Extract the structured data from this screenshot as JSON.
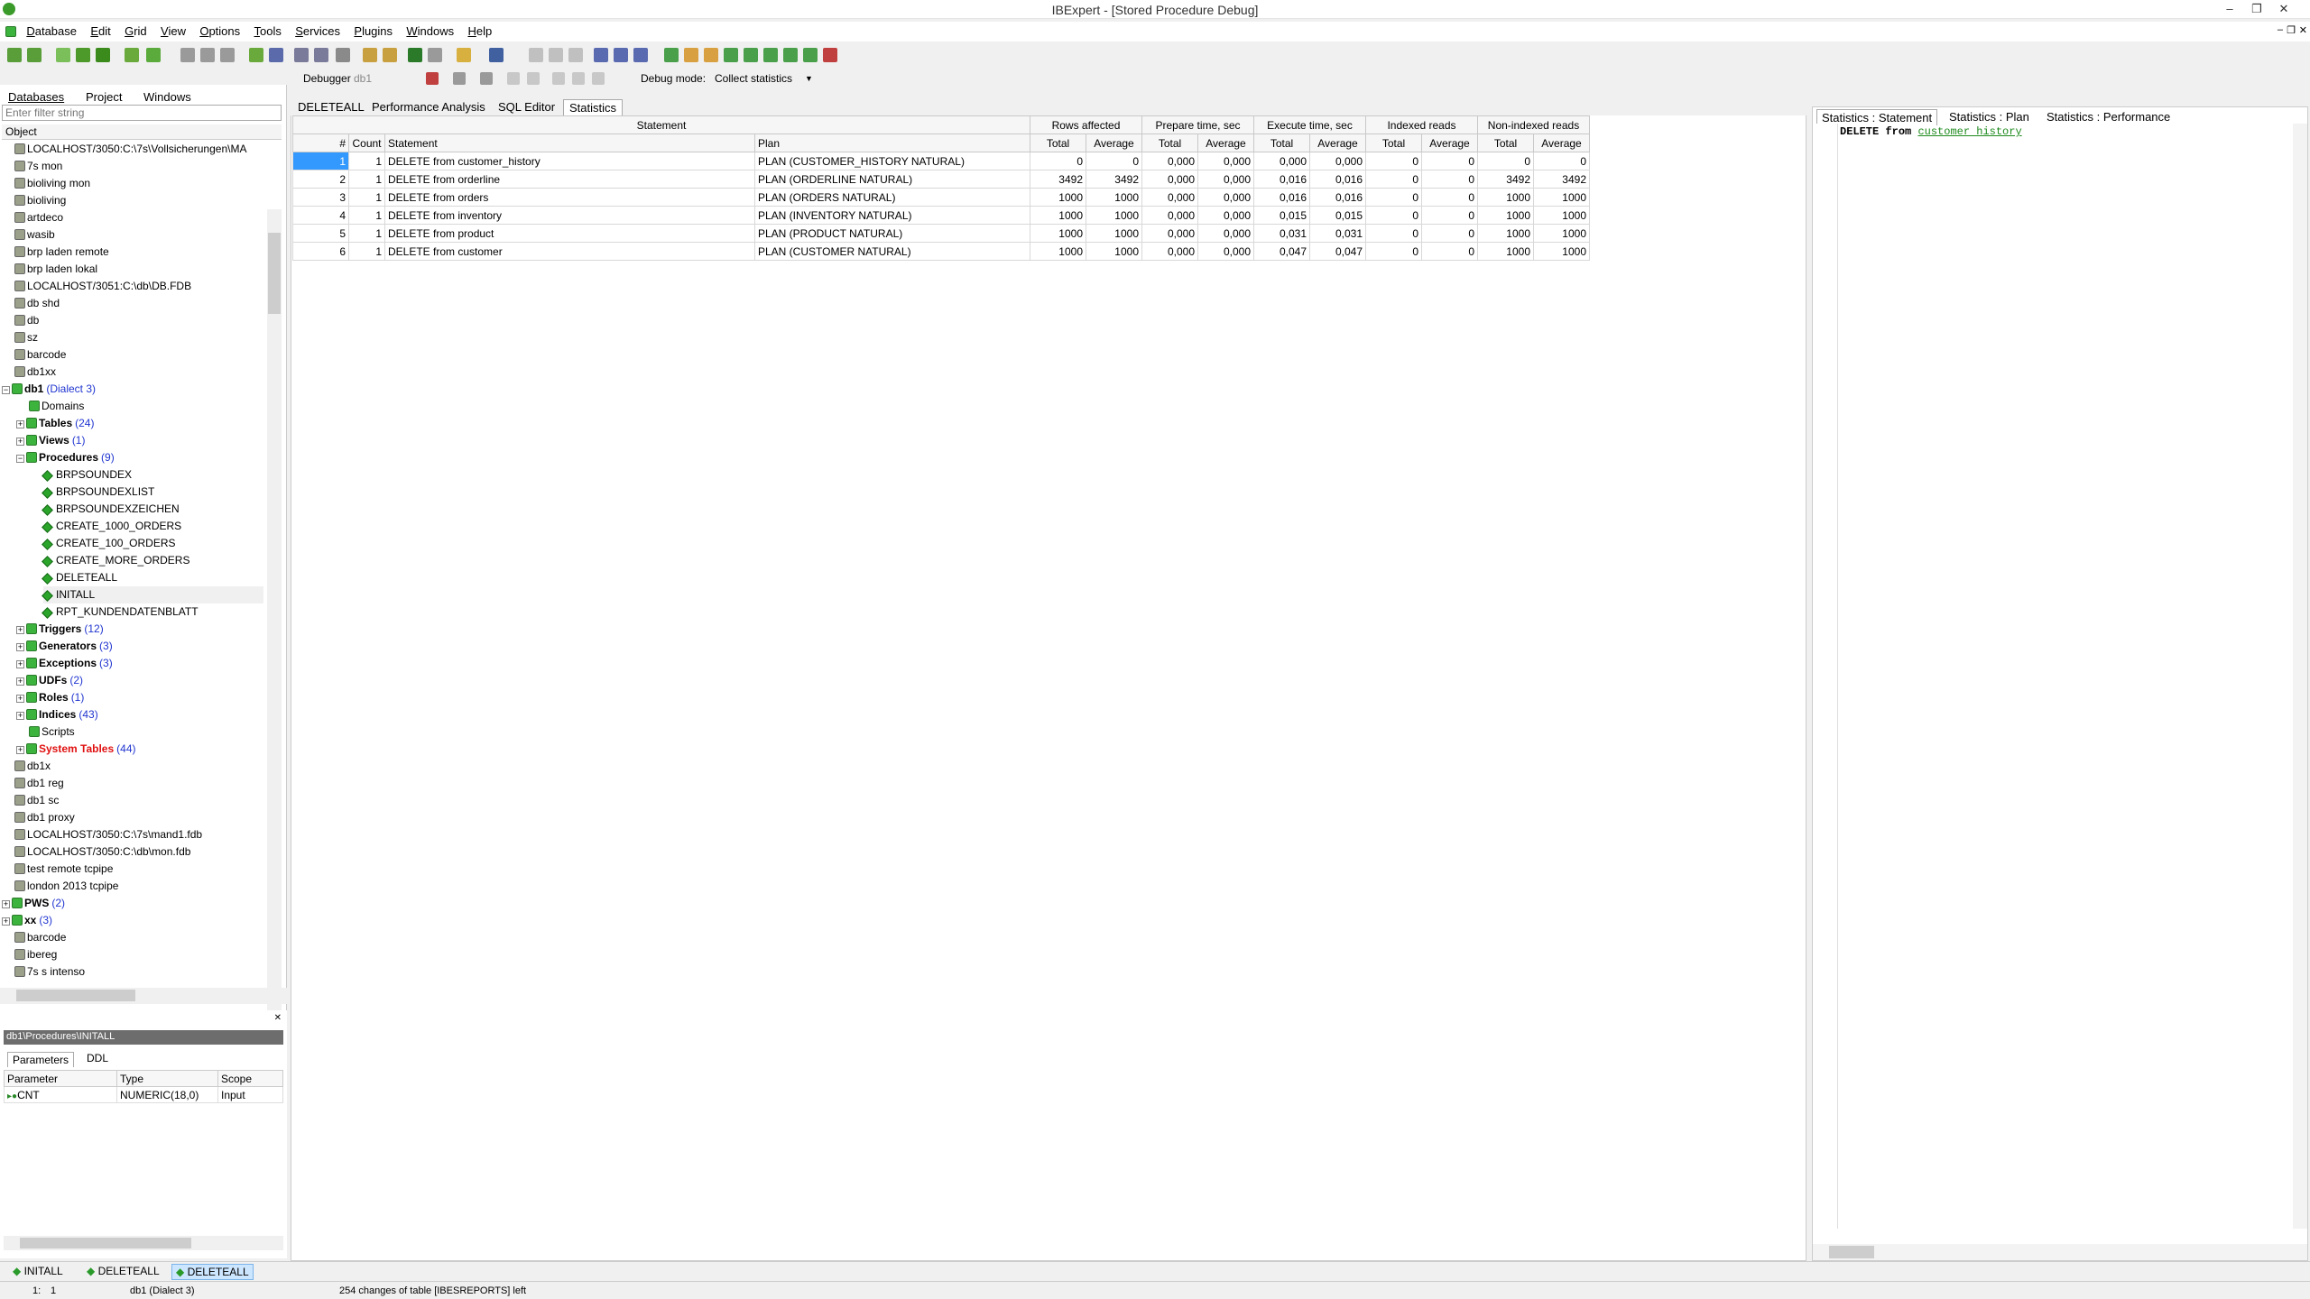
{
  "window": {
    "title": "IBExpert - [Stored Procedure Debug]"
  },
  "menu": [
    "Database",
    "Edit",
    "Grid",
    "View",
    "Options",
    "Tools",
    "Services",
    "Plugins",
    "Windows",
    "Help"
  ],
  "toolbar2": {
    "debugger_label": "Debugger",
    "db_label": "db1",
    "debug_mode_label": "Debug mode:",
    "debug_mode_value": "Collect statistics"
  },
  "left": {
    "tabs": [
      "Databases",
      "Project",
      "Windows"
    ],
    "filter_placeholder": "Enter filter string",
    "object_header": "Object",
    "tree": [
      {
        "label": "LOCALHOST/3050:C:\\7s\\Vollsicherungen\\MA",
        "indent": 0,
        "type": "db"
      },
      {
        "label": "7s mon",
        "indent": 0,
        "type": "db"
      },
      {
        "label": "bioliving mon",
        "indent": 0,
        "type": "db"
      },
      {
        "label": "bioliving",
        "indent": 0,
        "type": "db"
      },
      {
        "label": "artdeco",
        "indent": 0,
        "type": "db"
      },
      {
        "label": "wasib",
        "indent": 0,
        "type": "db"
      },
      {
        "label": "brp laden remote",
        "indent": 0,
        "type": "db"
      },
      {
        "label": "brp laden lokal",
        "indent": 0,
        "type": "db"
      },
      {
        "label": "LOCALHOST/3051:C:\\db\\DB.FDB",
        "indent": 0,
        "type": "db"
      },
      {
        "label": "db shd",
        "indent": 0,
        "type": "db"
      },
      {
        "label": "db",
        "indent": 0,
        "type": "db"
      },
      {
        "label": "sz",
        "indent": 0,
        "type": "db"
      },
      {
        "label": "barcode",
        "indent": 0,
        "type": "db"
      },
      {
        "label": "db1xx",
        "indent": 0,
        "type": "db"
      },
      {
        "label": "db1",
        "count": "(Dialect 3)",
        "indent": 0,
        "type": "dbopen",
        "bold": true,
        "exp": "−"
      },
      {
        "label": "Domains",
        "indent": 1,
        "type": "folder"
      },
      {
        "label": "Tables",
        "count": "(24)",
        "indent": 1,
        "type": "folder",
        "bold": true,
        "exp": "+"
      },
      {
        "label": "Views",
        "count": "(1)",
        "indent": 1,
        "type": "folder",
        "bold": true,
        "exp": "+"
      },
      {
        "label": "Procedures",
        "count": "(9)",
        "indent": 1,
        "type": "folder",
        "bold": true,
        "exp": "−"
      },
      {
        "label": "BRPSOUNDEX",
        "indent": 2,
        "type": "proc"
      },
      {
        "label": "BRPSOUNDEXLIST",
        "indent": 2,
        "type": "proc"
      },
      {
        "label": "BRPSOUNDEXZEICHEN",
        "indent": 2,
        "type": "proc"
      },
      {
        "label": "CREATE_1000_ORDERS",
        "indent": 2,
        "type": "proc"
      },
      {
        "label": "CREATE_100_ORDERS",
        "indent": 2,
        "type": "proc"
      },
      {
        "label": "CREATE_MORE_ORDERS",
        "indent": 2,
        "type": "proc"
      },
      {
        "label": "DELETEALL",
        "indent": 2,
        "type": "proc"
      },
      {
        "label": "INITALL",
        "indent": 2,
        "type": "proc",
        "selected": true
      },
      {
        "label": "RPT_KUNDENDATENBLATT",
        "indent": 2,
        "type": "proc"
      },
      {
        "label": "Triggers",
        "count": "(12)",
        "indent": 1,
        "type": "folder",
        "bold": true,
        "exp": "+"
      },
      {
        "label": "Generators",
        "count": "(3)",
        "indent": 1,
        "type": "folder",
        "bold": true,
        "exp": "+"
      },
      {
        "label": "Exceptions",
        "count": "(3)",
        "indent": 1,
        "type": "folder",
        "bold": true,
        "exp": "+"
      },
      {
        "label": "UDFs",
        "count": "(2)",
        "indent": 1,
        "type": "folder",
        "bold": true,
        "exp": "+"
      },
      {
        "label": "Roles",
        "count": "(1)",
        "indent": 1,
        "type": "folder",
        "bold": true,
        "exp": "+"
      },
      {
        "label": "Indices",
        "count": "(43)",
        "indent": 1,
        "type": "folder",
        "bold": true,
        "exp": "+"
      },
      {
        "label": "Scripts",
        "indent": 1,
        "type": "folder"
      },
      {
        "label": "System Tables",
        "count": "(44)",
        "indent": 1,
        "type": "folder",
        "bold": true,
        "red": true,
        "exp": "+"
      },
      {
        "label": "db1x",
        "indent": 0,
        "type": "db"
      },
      {
        "label": "db1 reg",
        "indent": 0,
        "type": "db"
      },
      {
        "label": "db1 sc",
        "indent": 0,
        "type": "db"
      },
      {
        "label": "db1 proxy",
        "indent": 0,
        "type": "db"
      },
      {
        "label": "LOCALHOST/3050:C:\\7s\\mand1.fdb",
        "indent": 0,
        "type": "db"
      },
      {
        "label": "LOCALHOST/3050:C:\\db\\mon.fdb",
        "indent": 0,
        "type": "db"
      },
      {
        "label": "test remote tcpipe",
        "indent": 0,
        "type": "db"
      },
      {
        "label": "london 2013 tcpipe",
        "indent": 0,
        "type": "db"
      },
      {
        "label": "PWS",
        "count": "(2)",
        "indent": 0,
        "type": "dbopen",
        "bold": true,
        "exp": "+"
      },
      {
        "label": "xx",
        "count": "(3)",
        "indent": 0,
        "type": "dbopen",
        "bold": true,
        "exp": "+"
      },
      {
        "label": "barcode",
        "indent": 0,
        "type": "db"
      },
      {
        "label": "ibereg",
        "indent": 0,
        "type": "db"
      },
      {
        "label": "7s s intenso",
        "indent": 0,
        "type": "db"
      }
    ]
  },
  "bottomleft": {
    "path": "db1\\Procedures\\INITALL",
    "tabs": [
      "Parameters",
      "DDL"
    ],
    "columns": [
      "Parameter",
      "Type",
      "Scope"
    ],
    "rows": [
      [
        "CNT",
        "NUMERIC(18,0)",
        "Input"
      ]
    ]
  },
  "center": {
    "tabs": [
      "DELETEALL",
      "Performance Analysis",
      "SQL Editor",
      "Statistics"
    ],
    "group_headers": [
      "Statement",
      "Rows affected",
      "Prepare time, sec",
      "Execute time, sec",
      "Indexed reads",
      "Non-indexed reads"
    ],
    "sub_headers": [
      "#",
      "Count",
      "Statement",
      "Plan",
      "Total",
      "Average",
      "Total",
      "Average",
      "Total",
      "Average",
      "Total",
      "Average",
      "Total",
      "Average"
    ],
    "rows": [
      [
        "1",
        "1",
        "DELETE from customer_history",
        "PLAN (CUSTOMER_HISTORY NATURAL)",
        "0",
        "0",
        "0,000",
        "0,000",
        "0,000",
        "0,000",
        "0",
        "0",
        "0",
        "0"
      ],
      [
        "2",
        "1",
        "DELETE from orderline",
        "PLAN (ORDERLINE NATURAL)",
        "3492",
        "3492",
        "0,000",
        "0,000",
        "0,016",
        "0,016",
        "0",
        "0",
        "3492",
        "3492"
      ],
      [
        "3",
        "1",
        "DELETE from orders",
        "PLAN (ORDERS NATURAL)",
        "1000",
        "1000",
        "0,000",
        "0,000",
        "0,016",
        "0,016",
        "0",
        "0",
        "1000",
        "1000"
      ],
      [
        "4",
        "1",
        "DELETE from inventory",
        "PLAN (INVENTORY NATURAL)",
        "1000",
        "1000",
        "0,000",
        "0,000",
        "0,015",
        "0,015",
        "0",
        "0",
        "1000",
        "1000"
      ],
      [
        "5",
        "1",
        "DELETE from product",
        "PLAN (PRODUCT NATURAL)",
        "1000",
        "1000",
        "0,000",
        "0,000",
        "0,031",
        "0,031",
        "0",
        "0",
        "1000",
        "1000"
      ],
      [
        "6",
        "1",
        "DELETE from customer",
        "PLAN (CUSTOMER NATURAL)",
        "1000",
        "1000",
        "0,000",
        "0,000",
        "0,047",
        "0,047",
        "0",
        "0",
        "1000",
        "1000"
      ]
    ]
  },
  "right": {
    "tabs": [
      "Statistics : Statement",
      "Statistics : Plan",
      "Statistics : Performance"
    ],
    "code_kw1": "DELETE",
    "code_kw2": "from",
    "code_table": "customer history"
  },
  "taskbar": [
    "INITALL",
    "DELETEALL",
    "DELETEALL"
  ],
  "status": {
    "pos_line": "1:",
    "pos_col": "1",
    "db": "db1 (Dialect 3)",
    "message": "254 changes of table [IBESREPORTS] left"
  }
}
